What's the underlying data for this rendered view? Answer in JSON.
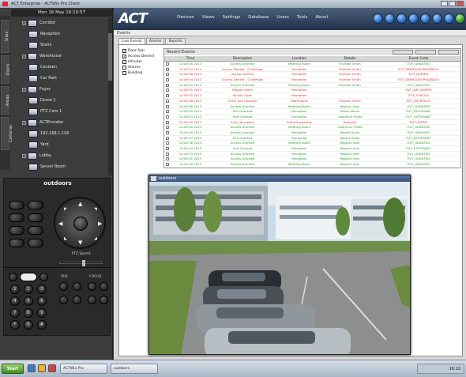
{
  "window": {
    "title": "ACT Enterprise - ACTWin Pro Client"
  },
  "sidebar": {
    "header": "Mon 16 May 16:10:57",
    "vtabs": [
      "Sites",
      "Doors",
      "Areas",
      "Cameras"
    ],
    "tree": [
      {
        "label": "Corridor"
      },
      {
        "label": "Reception"
      },
      {
        "label": "Stairs"
      },
      {
        "label": "Warehouse"
      },
      {
        "label": "Canteen"
      },
      {
        "label": "Car Park"
      },
      {
        "label": "Foyer"
      },
      {
        "label": "Dome 1"
      },
      {
        "label": "PTZ Cam 1"
      },
      {
        "label": "ACTEncoder"
      },
      {
        "label": "192.168.1.100"
      },
      {
        "label": "Yard"
      },
      {
        "label": "Lobby"
      },
      {
        "label": "Server Room"
      }
    ],
    "status": "User: Admin   Online"
  },
  "ptz": {
    "title": "outdoors",
    "speed_label": "PTZ Speed",
    "iris_label": "IRIS",
    "focus_label": "FOCUS",
    "keypad": [
      "1",
      "2",
      "3",
      "4",
      "5",
      "6",
      "7",
      "8",
      "9",
      "*",
      "0",
      "#"
    ]
  },
  "header": {
    "logo": "ACT",
    "menu": [
      "Devices",
      "Views",
      "Settings",
      "Database",
      "Users",
      "Tools",
      "About"
    ],
    "subbar": "Events"
  },
  "tabs": [
    "Live Events",
    "Alarms",
    "Reports"
  ],
  "filters": [
    {
      "label": "Door Ajar",
      "checked": true
    },
    {
      "label": "Access Denied",
      "checked": true
    },
    {
      "label": "Intruder",
      "checked": false
    },
    {
      "label": "Alarms",
      "checked": false
    },
    {
      "label": "Building",
      "checked": false
    }
  ],
  "events": {
    "title": "Recent Events",
    "columns": [
      "Time",
      "Description",
      "Location",
      "Details",
      "Event Code"
    ],
    "rows": [
      {
        "time": "14:09:58 2013",
        "desc": "Access Granted",
        "loc": "Meeting Room",
        "det": "Michael Smith",
        "code": "EVT_GRANTED",
        "color": "#2f9a2f"
      },
      {
        "time": "14:09:57 2013",
        "desc": "Access Denied - Challenge",
        "loc": "Reception",
        "det": "Michael Smith",
        "code": "EVT_DENIED/NOPASSBACK",
        "color": "#d43a3a"
      },
      {
        "time": "14:09:56 2013",
        "desc": "Access Denied",
        "loc": "Reception",
        "det": "Michael Smith",
        "code": "EVT_DENIED",
        "color": "#d43a3a"
      },
      {
        "time": "14:09:54 2013",
        "desc": "Access Denied - Challenge",
        "loc": "Reception",
        "det": "Michael Smith",
        "code": "EVT_DENIED/NOPASSBACK",
        "color": "#d43a3a"
      },
      {
        "time": "14:09:52 2013",
        "desc": "Access Granted",
        "loc": "Meeting Room",
        "det": "Michael Smith",
        "code": "EVT_GRANTED",
        "color": "#2f9a2f"
      },
      {
        "time": "14:09:51 2013",
        "desc": "Tamper Alarm",
        "loc": "Reception",
        "det": "",
        "code": "EVT_AIR.TAMPER",
        "color": "#d43a3a"
      },
      {
        "time": "14:09:50 2013",
        "desc": "Forced Open",
        "loc": "Reception",
        "det": "",
        "code": "EVT_FORCED",
        "color": "#d43a3a"
      },
      {
        "time": "14:09:48 2013",
        "desc": "Entry Exit Request",
        "loc": "Warehouse",
        "det": "Michael Smith",
        "code": "EVT_ENTRY.EXIT",
        "color": "#d43a3a"
      },
      {
        "time": "14:09:46 2013",
        "desc": "Access Granted",
        "loc": "Meeting Room",
        "det": "Regular User",
        "code": "EVT_GRANTED",
        "color": "#2f9a2f"
      },
      {
        "time": "14:09:45 2013",
        "desc": "Exit Granted",
        "loc": "Reception",
        "det": "Stella Atkins",
        "code": "EVT_EXITGRANT",
        "color": "#2f9a2f"
      },
      {
        "time": "14:09:43 2013",
        "desc": "Exit Granted",
        "loc": "Reception",
        "det": "Lawrence Prado",
        "code": "EVT_EXITGRANT",
        "color": "#2f9a2f"
      },
      {
        "time": "14:09:42 2013",
        "desc": "Entry Accepted",
        "loc": "Internal possible",
        "det": "Daventri",
        "code": "EVT_ENTRY",
        "color": "#d43a3a"
      },
      {
        "time": "14:09:40 2013",
        "desc": "Access Granted",
        "loc": "Meeting Room",
        "det": "Lawrence Prado",
        "code": "EVT_GRANTED",
        "color": "#2f9a2f"
      },
      {
        "time": "14:09:39 2013",
        "desc": "Access Granted",
        "loc": "Reception",
        "det": "Robert Dixon",
        "code": "EVT_GRANTED",
        "color": "#2f9a2f"
      },
      {
        "time": "14:09:37 2013",
        "desc": "Exit Granted",
        "loc": "Reception",
        "det": "Robert Dixon",
        "code": "EVT_EXITGRANT",
        "color": "#2f9a2f"
      },
      {
        "time": "14:09:36 2013",
        "desc": "Access Granted",
        "loc": "Meeting Room",
        "det": "Regular User",
        "code": "EVT_GRANTED",
        "color": "#2f9a2f"
      },
      {
        "time": "14:09:34 2013",
        "desc": "Exit Granted",
        "loc": "Reception",
        "det": "Regular User",
        "code": "EVT_EXITGRANT",
        "color": "#2f9a2f"
      },
      {
        "time": "14:09:33 2013",
        "desc": "Access Granted",
        "loc": "Reception",
        "det": "Regular User",
        "code": "EVT_GRANTED",
        "color": "#2f9a2f"
      },
      {
        "time": "14:09:31 2013",
        "desc": "Access Granted",
        "loc": "Reception",
        "det": "Regular User",
        "code": "EVT_GRANTED",
        "color": "#2f9a2f"
      },
      {
        "time": "14:09:30 2013",
        "desc": "Access Granted",
        "loc": "Meeting Room",
        "det": "Regular User",
        "code": "EVT_GRANTED",
        "color": "#2f9a2f"
      },
      {
        "time": "14:09:28 2013",
        "desc": "Access Granted",
        "loc": "Reception",
        "det": "Regular User",
        "code": "EVT_GRANTED",
        "color": "#2f9a2f"
      }
    ]
  },
  "video": {
    "title": "outdoors"
  },
  "mainstatus": "Connected to ACT Enterprise Server - 192.168.0.10",
  "taskbar": {
    "start": "Start",
    "tasks": [
      "ACTWin Pro",
      "outdoors"
    ],
    "clock": "16:10"
  },
  "colors": {
    "granted": "#2f9a2f",
    "denied": "#d43a3a",
    "header_blue": "#20324a"
  }
}
